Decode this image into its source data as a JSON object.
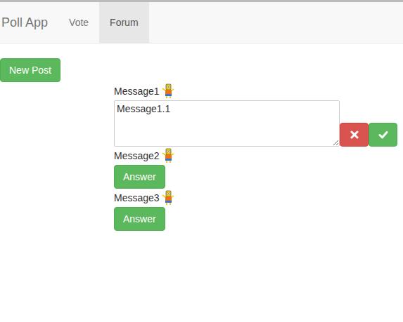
{
  "app": {
    "brand": "Poll App"
  },
  "tabs": [
    {
      "label": "Vote",
      "selected": false
    },
    {
      "label": "Forum",
      "selected": true
    }
  ],
  "new_post": "New Post",
  "messages": [
    {
      "text": "Message1",
      "kind": "reply",
      "reply": "Message1.1"
    },
    {
      "text": "Message2",
      "kind": "answer",
      "button": "Answer"
    },
    {
      "text": "Message3",
      "kind": "answer",
      "button": "Answer"
    }
  ]
}
